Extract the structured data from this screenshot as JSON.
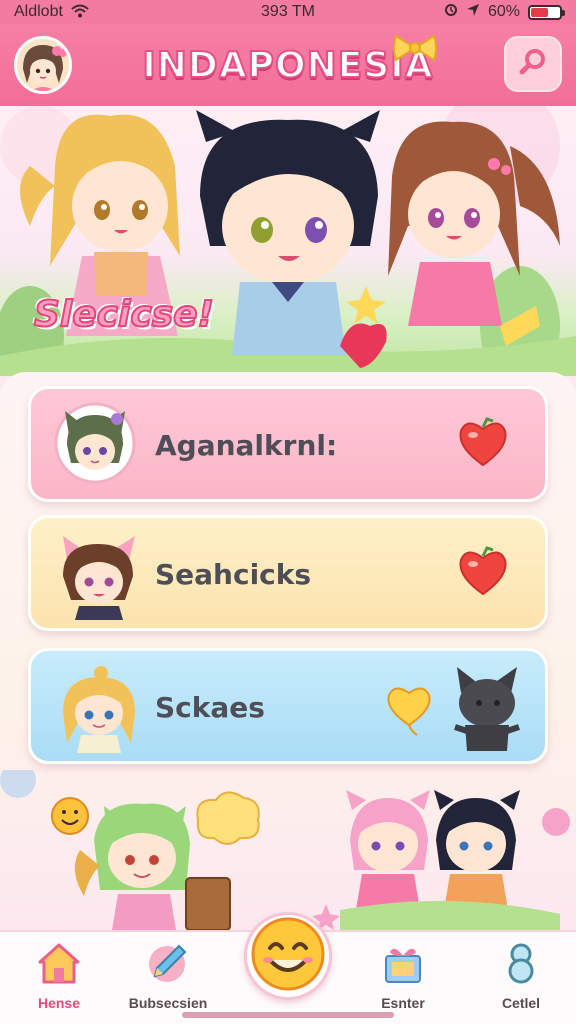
{
  "status_bar": {
    "carrier": "Aldlobt",
    "time": "393 TM",
    "battery": "60%",
    "battery_level": 0.6
  },
  "header": {
    "title": "INDAPONESIA",
    "avatar_icon": "avatar-girl-icon",
    "action_icon": "search-icon"
  },
  "hero": {
    "badge": "Slecicse!"
  },
  "menu": {
    "items": [
      {
        "label": "Aganalkrnl:",
        "icon": "heart-icon",
        "color": "#fbb6c8"
      },
      {
        "label": "Seahcicks",
        "icon": "heart-icon",
        "color": "#fbe3ae"
      },
      {
        "label": "Sckaes",
        "icon": "heart-balloon-icon",
        "color": "#a9dcf6"
      }
    ]
  },
  "tabs": [
    {
      "label": "Hense",
      "icon": "home-icon",
      "active": true
    },
    {
      "label": "Bubsecsien",
      "icon": "pencil-icon",
      "active": false
    },
    {
      "label": "",
      "icon": "smiley-icon",
      "active": false
    },
    {
      "label": "Esnter",
      "icon": "gift-icon",
      "active": false
    },
    {
      "label": "Cetlel",
      "icon": "number-8-icon",
      "active": false
    }
  ],
  "colors": {
    "brand_pink": "#f26e98",
    "accent_text": "#e24b78"
  }
}
